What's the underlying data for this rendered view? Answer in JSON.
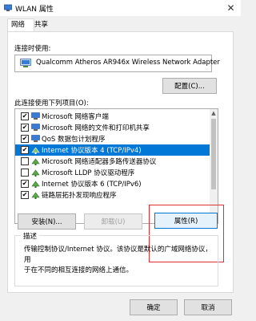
{
  "window": {
    "title": "WLAN 属性",
    "close_glyph": "✕"
  },
  "tabs": [
    {
      "label": "网络",
      "active": true
    },
    {
      "label": "共享",
      "active": false
    }
  ],
  "connect_using": {
    "label": "连接时使用:",
    "adapter_name": "Qualcomm Atheros AR946x Wireless Network Adapter",
    "configure_button": "配置(C)..."
  },
  "items_section": {
    "label": "此连接使用下列项目(O):",
    "items": [
      {
        "label": "Microsoft 网络客户端",
        "checked": true,
        "selected": false,
        "icon": "network-client-icon"
      },
      {
        "label": "Microsoft 网络的文件和打印机共享",
        "checked": true,
        "selected": false,
        "icon": "network-client-icon"
      },
      {
        "label": "QoS 数据包计划程序",
        "checked": true,
        "selected": false,
        "icon": "network-client-icon"
      },
      {
        "label": "Internet 协议版本 4 (TCP/IPv4)",
        "checked": true,
        "selected": true,
        "icon": "protocol-icon"
      },
      {
        "label": "Microsoft 网络适配器多路传送器协议",
        "checked": false,
        "selected": false,
        "icon": "protocol-icon"
      },
      {
        "label": "Microsoft LLDP 协议驱动程序",
        "checked": false,
        "selected": false,
        "icon": "protocol-icon"
      },
      {
        "label": "Internet 协议版本 6 (TCP/IPv6)",
        "checked": true,
        "selected": false,
        "icon": "protocol-icon"
      },
      {
        "label": "链路层拓扑发现响应程序",
        "checked": true,
        "selected": false,
        "icon": "protocol-icon"
      }
    ]
  },
  "action_buttons": {
    "install": "安装(N)...",
    "uninstall": "卸载(U)",
    "properties": "属性(R)"
  },
  "description": {
    "legend": "描述",
    "text_line1": "传输控制协议/Internet 协议。该协议是默认的广域网络协议，用",
    "text_line2": "于在不同的相互连接的网络上通信。"
  },
  "dialog_buttons": {
    "ok": "确定",
    "cancel": "取消"
  },
  "colors": {
    "selection": "#0078d7",
    "highlight_box": "#e03030"
  }
}
